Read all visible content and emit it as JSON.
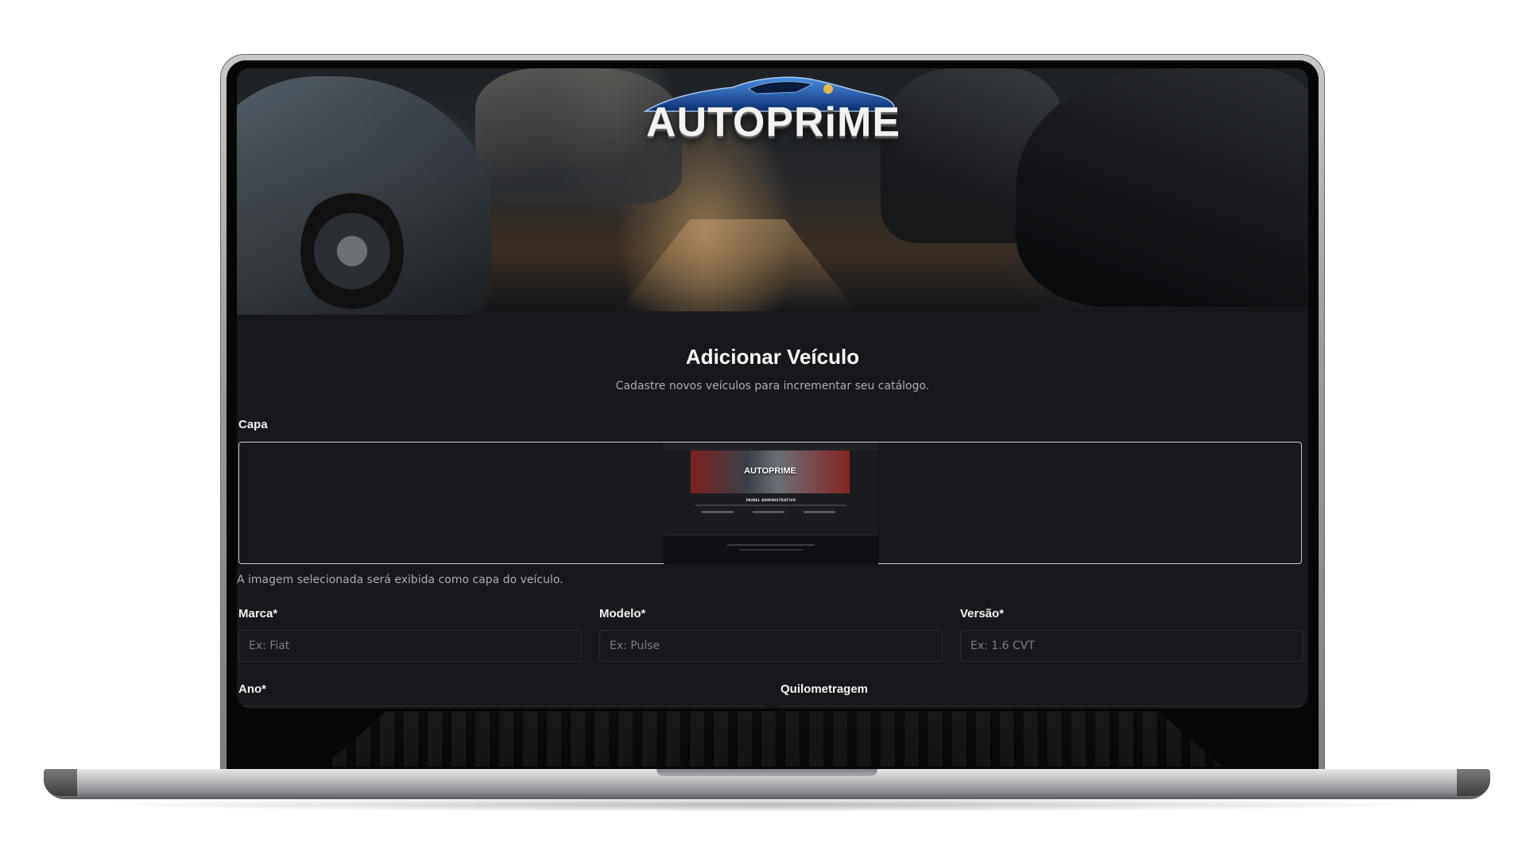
{
  "brand": {
    "logo_text": "AUTOPRiME"
  },
  "page": {
    "title": "Adicionar Veículo",
    "subtitle": "Cadastre novos veículos para incrementar seu catálogo."
  },
  "cover": {
    "label": "Capa",
    "helper": "A imagem selecionada será exibida como capa do veículo.",
    "preview": {
      "logo_text": "AUTOPRIME",
      "title": "PAINEL ADMINISTRATIVO"
    }
  },
  "fields": {
    "marca": {
      "label": "Marca*",
      "placeholder": "Ex: Fiat"
    },
    "modelo": {
      "label": "Modelo*",
      "placeholder": "Ex: Pulse"
    },
    "versao": {
      "label": "Versão*",
      "placeholder": "Ex: 1.6 CVT"
    },
    "ano": {
      "label": "Ano*"
    },
    "quilometragem": {
      "label": "Quilometragem"
    }
  },
  "colors": {
    "background": "#16181c",
    "text": "#ffffff",
    "muted": "#a9adb3",
    "input_border": "#2a2d33"
  }
}
